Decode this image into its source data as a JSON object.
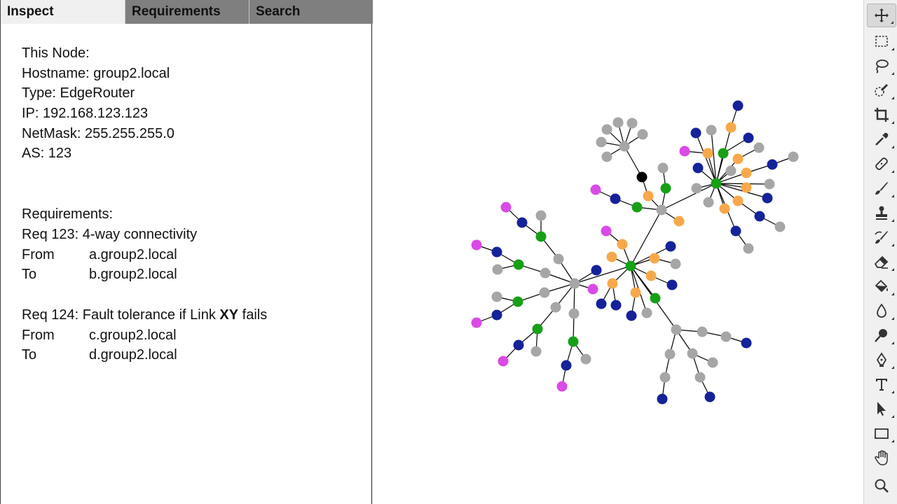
{
  "tabs": [
    {
      "label": "Inspect"
    },
    {
      "label": "Requirements"
    },
    {
      "label": "Search"
    }
  ],
  "inspect": {
    "heading": "This Node:",
    "hostname": "Hostname: group2.local",
    "type": "Type: EdgeRouter",
    "ip": "IP: 192.168.123.123",
    "netmask": "NetMask: 255.255.255.0",
    "as": "AS: 123"
  },
  "requirements": {
    "heading": "Requirements:",
    "req123": {
      "title": "Req 123: 4-way connectivity",
      "from_label": "From",
      "from_value": "a.group2.local",
      "to_label": "To",
      "to_value": "b.group2.local"
    },
    "req124": {
      "title_prefix": "Req 124: Fault tolerance if Link ",
      "title_bold": "XY",
      "title_suffix": " fails",
      "from_label": "From",
      "from_value": "c.group2.local",
      "to_label": "To",
      "to_value": "d.group2.local"
    }
  },
  "colors": {
    "gray": "#a6a6a6",
    "navy": "#15229a",
    "green": "#16a016",
    "orange": "#f8a84a",
    "magenta": "#d94ae6",
    "black": "#000000",
    "edge": "#000000"
  },
  "toolbar": {
    "tools": [
      "move-tool-icon",
      "marquee-tool-icon",
      "lasso-tool-icon",
      "quick-select-icon",
      "crop-tool-icon",
      "eyedropper-icon",
      "healing-brush-icon",
      "brush-tool-icon",
      "clone-stamp-icon",
      "history-brush-icon",
      "eraser-icon",
      "paint-bucket-icon",
      "blur-tool-icon",
      "dodge-tool-icon",
      "pen-tool-icon",
      "type-tool-icon",
      "path-select-icon",
      "rectangle-tool-icon",
      "hand-tool-icon",
      "zoom-tool-icon"
    ]
  }
}
